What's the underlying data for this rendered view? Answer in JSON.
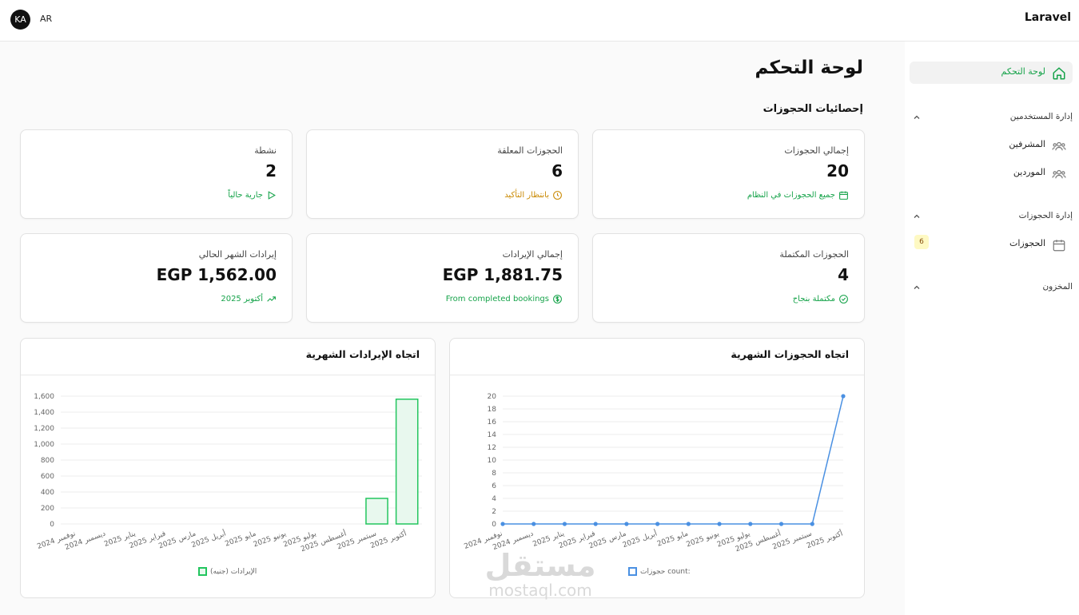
{
  "topbar": {
    "brand": "Laravel",
    "avatar": "KA",
    "lang": "AR"
  },
  "sidebar": {
    "dashboard": "لوحة التحكم",
    "user_mgmt": "إدارة المستخدمين",
    "supervisors": "المشرفين",
    "suppliers": "الموردين",
    "bookings_mgmt": "إدارة الحجوزات",
    "bookings": "الحجوزات",
    "bookings_badge": "6",
    "inventory": "المخزون"
  },
  "page": {
    "title": "لوحة التحكم",
    "section": "إحصائيات الحجوزات"
  },
  "cards": [
    {
      "title": "إجمالي الحجوزات",
      "value": "20",
      "foot": "جميع الحجوزات في النظام",
      "icon": "calendar-icon",
      "color": "#16a34a"
    },
    {
      "title": "الحجوزات المعلقة",
      "value": "6",
      "foot": "بانتظار التأكيد",
      "icon": "clock-icon",
      "color": "#ca8a04"
    },
    {
      "title": "نشطة",
      "value": "2",
      "foot": "جارية حالياً",
      "icon": "play-icon",
      "color": "#16a34a"
    },
    {
      "title": "الحجوزات المكتملة",
      "value": "4",
      "foot": "مكتملة بنجاح",
      "icon": "check-circle-icon",
      "color": "#16a34a"
    },
    {
      "title": "إجمالي الإيرادات",
      "value": "EGP 1,881.75",
      "foot": "From completed bookings",
      "icon": "dollar-icon",
      "color": "#16a34a"
    },
    {
      "title": "إيرادات الشهر الحالي",
      "value": "EGP 1,562.00",
      "foot": "أكتوبر 2025",
      "icon": "trend-up-icon",
      "color": "#16a34a"
    }
  ],
  "chart_data": [
    {
      "type": "line",
      "title": "اتجاه الحجوزات الشهرية",
      "categories": [
        "نوفمبر 2024",
        "ديسمبر 2024",
        "يناير 2025",
        "فبراير 2025",
        "مارس 2025",
        "أبريل 2025",
        "مايو 2025",
        "يونيو 2025",
        "يوليو 2025",
        "أغسطس 2025",
        "سبتمبر 2025",
        "أكتوبر 2025"
      ],
      "series": [
        {
          "name": "حجوزات count:",
          "values": [
            0,
            0,
            0,
            0,
            0,
            0,
            0,
            0,
            0,
            0,
            0,
            20
          ]
        }
      ],
      "ylim": [
        0,
        20
      ],
      "yticks": [
        0,
        2,
        4,
        6,
        8,
        10,
        12,
        14,
        16,
        18,
        20
      ],
      "color": "#4a90e2",
      "grid": true,
      "legend": "bottom"
    },
    {
      "type": "bar",
      "title": "اتجاه الإيرادات الشهرية",
      "categories": [
        "نوفمبر 2024",
        "ديسمبر 2024",
        "يناير 2025",
        "فبراير 2025",
        "مارس 2025",
        "أبريل 2025",
        "مايو 2025",
        "يونيو 2025",
        "يوليو 2025",
        "أغسطس 2025",
        "سبتمبر 2025",
        "أكتوبر 2025"
      ],
      "series": [
        {
          "name": "الإيرادات (جنيه)",
          "values": [
            0,
            0,
            0,
            0,
            0,
            0,
            0,
            0,
            0,
            0,
            320,
            1562
          ]
        }
      ],
      "ylim": [
        0,
        1600
      ],
      "yticks": [
        0,
        200,
        400,
        600,
        800,
        1000,
        1200,
        1400,
        1600
      ],
      "ytick_labels": [
        "0",
        "200",
        "400",
        "600",
        "800",
        "1,000",
        "1,200",
        "1,400",
        "1,600"
      ],
      "color": "#22c55e",
      "grid": true,
      "legend": "bottom"
    }
  ],
  "watermark": {
    "arabic": "مستقل",
    "latin": "mostaql.com"
  }
}
